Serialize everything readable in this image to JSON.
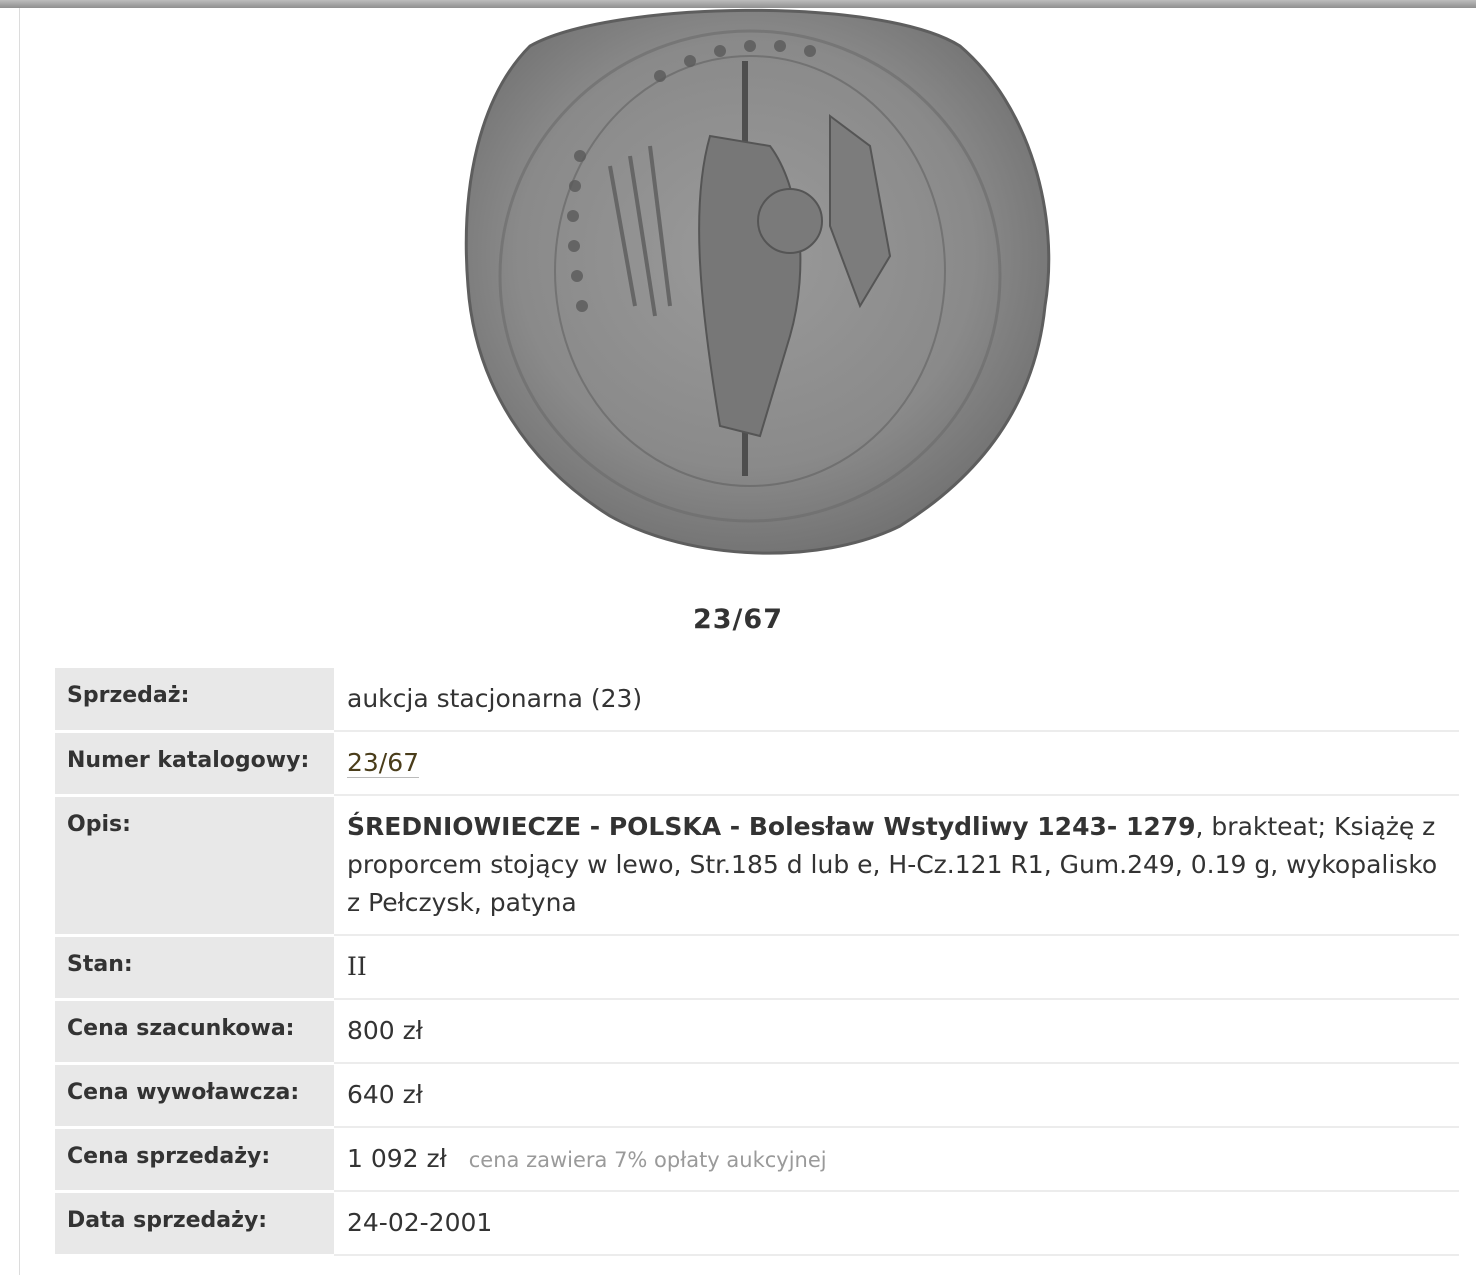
{
  "lot": {
    "caption": "23/67"
  },
  "image": {
    "icon": "coin-bracteate-image"
  },
  "details": {
    "sale": {
      "label": "Sprzedaż:",
      "value": "aukcja stacjonarna (23)"
    },
    "catalog": {
      "label": "Numer katalogowy:",
      "value": "23/67"
    },
    "description": {
      "label": "Opis:",
      "title": "ŚREDNIOWIECZE - POLSKA - Bolesław Wstydliwy 1243- 1279",
      "text": ", brakteat; Książę z proporcem stojący w lewo, Str.185 d lub e, H-Cz.121 R1, Gum.249, 0.19 g, wykopalisko z Pełczysk, patyna"
    },
    "condition": {
      "label": "Stan:",
      "value": "II"
    },
    "estimate": {
      "label": "Cena szacunkowa:",
      "value": "800 zł"
    },
    "starting": {
      "label": "Cena wywoławcza:",
      "value": "640 zł"
    },
    "sold": {
      "label": "Cena sprzedaży:",
      "value": "1 092 zł",
      "note": "cena zawiera 7% opłaty aukcyjnej"
    },
    "date": {
      "label": "Data sprzedaży:",
      "value": "24-02-2001"
    }
  }
}
